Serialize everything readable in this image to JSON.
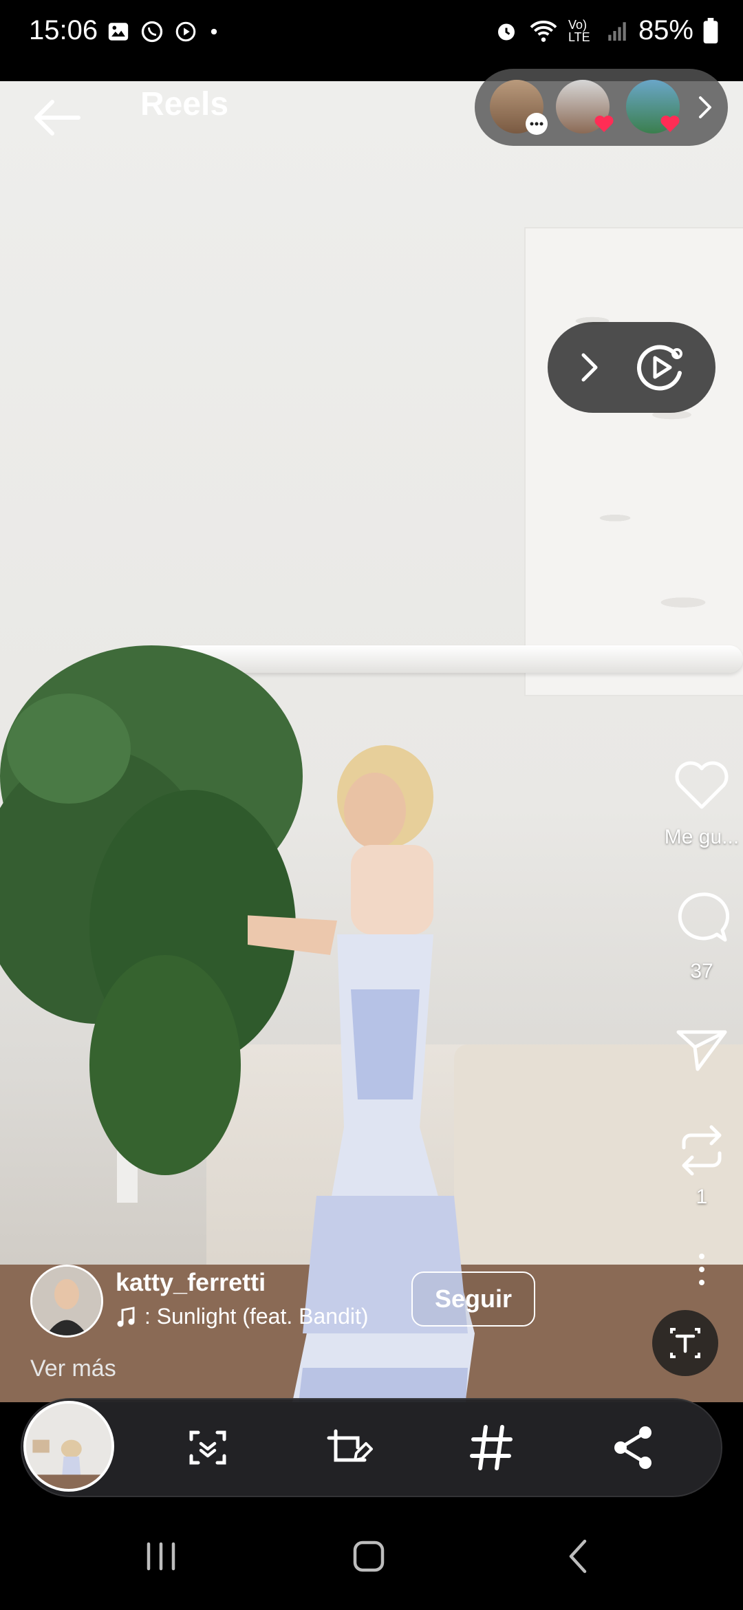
{
  "status_bar": {
    "time": "15:06",
    "battery": "85%",
    "network": "Vo) LTE",
    "icons_left": [
      "gallery-icon",
      "whatsapp-icon",
      "media-icon",
      "dot-icon"
    ],
    "icons_right": [
      "alarm-icon",
      "wifi-icon",
      "lte-icon",
      "signal-icon",
      "battery-icon"
    ]
  },
  "header": {
    "title": "Reels",
    "back_icon": "back-arrow-icon",
    "stories": [
      {
        "badge": "comment",
        "badge_color": "#ffffff"
      },
      {
        "badge": "heart",
        "badge_color": "#ff2d55"
      },
      {
        "badge": "heart",
        "badge_color": "#ff2d55"
      }
    ]
  },
  "actions": {
    "like_label": "Me gu...",
    "comments": "37",
    "shares": "1"
  },
  "post": {
    "username": "katty_ferretti",
    "song": ": Sunlight (feat. Bandit)",
    "follow_label": "Seguir",
    "more_label": "Ver más"
  },
  "toolbar": {
    "tools": [
      "scan-icon",
      "edit-icon",
      "hashtag-icon",
      "share-icon"
    ]
  },
  "navbar": {
    "buttons": [
      "recents-icon",
      "home-icon",
      "back-icon"
    ]
  },
  "colors": {
    "accent_heart": "#ff2d55",
    "toolbar_bg": "#232326"
  }
}
